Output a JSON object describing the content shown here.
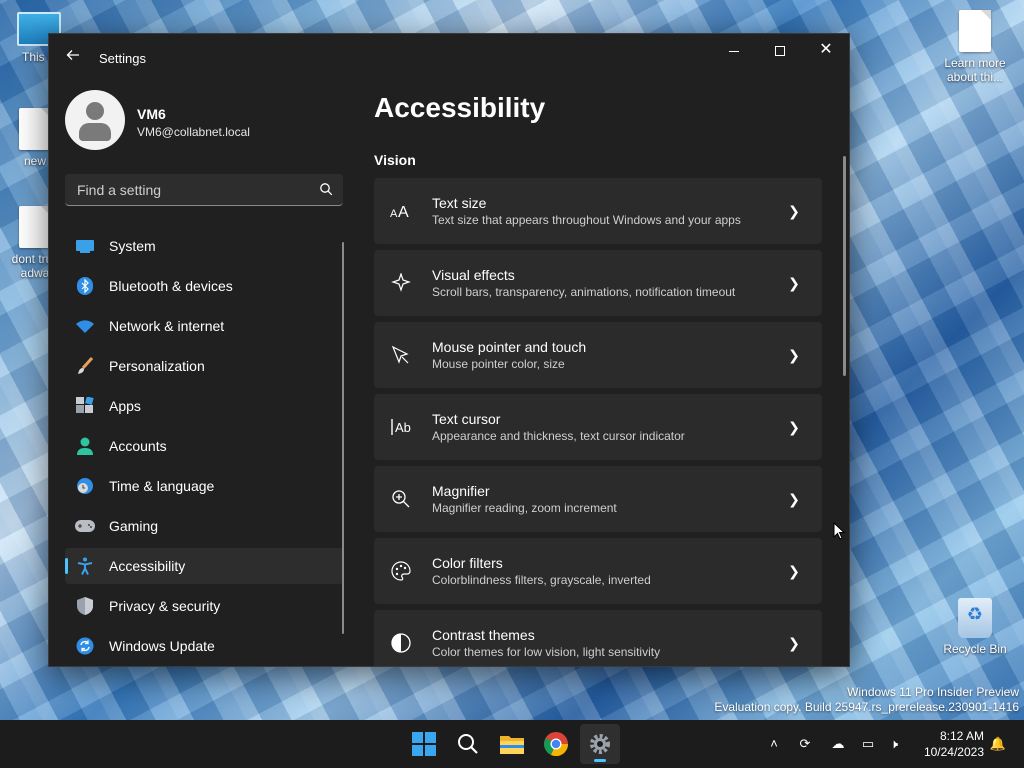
{
  "desktop": {
    "icons": [
      {
        "label": "This P"
      },
      {
        "label": "new"
      },
      {
        "label": "dont trus adwa"
      },
      {
        "label": "Learn more about thi..."
      },
      {
        "label": "Recycle Bin"
      }
    ]
  },
  "window": {
    "title": "Settings",
    "back_icon": "arrow-left-icon",
    "controls": {
      "minimize": "minimize",
      "maximize": "maximize",
      "close": "✕"
    }
  },
  "profile": {
    "name": "VM6",
    "email": "VM6@collabnet.local"
  },
  "search": {
    "placeholder": "Find a setting",
    "value": ""
  },
  "nav": {
    "items": [
      {
        "label": "System",
        "icon": "monitor-icon"
      },
      {
        "label": "Bluetooth & devices",
        "icon": "bluetooth-icon"
      },
      {
        "label": "Network & internet",
        "icon": "wifi-icon"
      },
      {
        "label": "Personalization",
        "icon": "brush-icon"
      },
      {
        "label": "Apps",
        "icon": "apps-icon"
      },
      {
        "label": "Accounts",
        "icon": "person-icon"
      },
      {
        "label": "Time & language",
        "icon": "clock-globe-icon"
      },
      {
        "label": "Gaming",
        "icon": "gamepad-icon"
      },
      {
        "label": "Accessibility",
        "icon": "accessibility-icon",
        "active": true
      },
      {
        "label": "Privacy & security",
        "icon": "shield-icon"
      },
      {
        "label": "Windows Update",
        "icon": "update-icon"
      }
    ],
    "accent_color": "#4cc2ff"
  },
  "main": {
    "page_title": "Accessibility",
    "section_title": "Vision",
    "cards": [
      {
        "title": "Text size",
        "subtitle": "Text size that appears throughout Windows and your apps",
        "icon": "text-size-icon"
      },
      {
        "title": "Visual effects",
        "subtitle": "Scroll bars, transparency, animations, notification timeout",
        "icon": "sparkle-icon"
      },
      {
        "title": "Mouse pointer and touch",
        "subtitle": "Mouse pointer color, size",
        "icon": "pointer-icon"
      },
      {
        "title": "Text cursor",
        "subtitle": "Appearance and thickness, text cursor indicator",
        "icon": "text-cursor-icon"
      },
      {
        "title": "Magnifier",
        "subtitle": "Magnifier reading, zoom increment",
        "icon": "magnifier-icon"
      },
      {
        "title": "Color filters",
        "subtitle": "Colorblindness filters, grayscale, inverted",
        "icon": "palette-icon"
      },
      {
        "title": "Contrast themes",
        "subtitle": "Color themes for low vision, light sensitivity",
        "icon": "contrast-icon"
      }
    ]
  },
  "watermark": {
    "line1": "Windows 11 Pro Insider Preview",
    "line2": "Evaluation copy. Build 25947.rs_prerelease.230901-1416"
  },
  "taskbar": {
    "apps": [
      "start-icon",
      "search-icon",
      "file-explorer-icon",
      "chrome-icon",
      "settings-icon"
    ],
    "active_app": "settings-icon",
    "tray": [
      "chevron-up-icon",
      "sync-icon",
      "onedrive-icon",
      "network-icon",
      "volume-muted-icon",
      "notification-icon"
    ],
    "time": "8:12 AM",
    "date": "10/24/2023"
  }
}
